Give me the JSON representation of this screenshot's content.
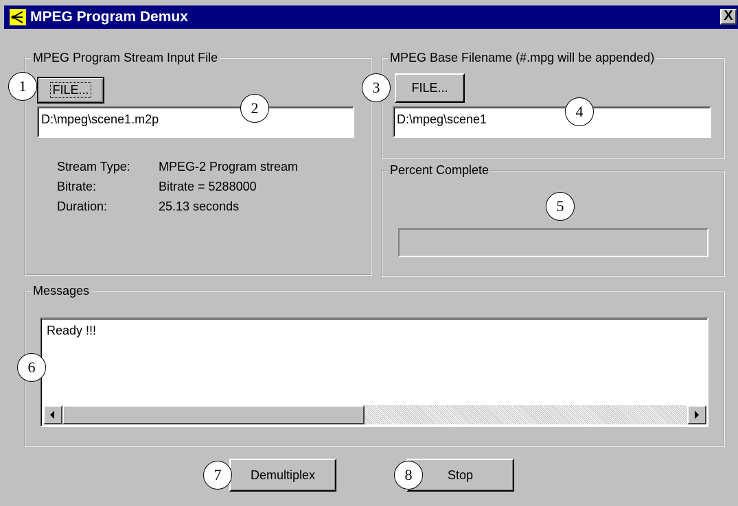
{
  "window": {
    "title": "MPEG Program Demux",
    "close_glyph": "X",
    "icon": "demux-app-icon"
  },
  "input_group": {
    "label": "MPEG Program Stream Input File",
    "file_button": "FILE...",
    "path_value": "D:\\mpeg\\scene1.m2p",
    "info": [
      {
        "label": "Stream Type:",
        "value": "MPEG-2 Program stream"
      },
      {
        "label": "Bitrate:",
        "value": "Bitrate = 5288000"
      },
      {
        "label": "Duration:",
        "value": "25.13 seconds"
      }
    ]
  },
  "output_group": {
    "label": "MPEG Base Filename (#.mpg will be appended)",
    "file_button": "FILE...",
    "path_value": "D:\\mpeg\\scene1"
  },
  "progress_group": {
    "label": "Percent Complete",
    "percent_complete": 0
  },
  "messages_group": {
    "label": "Messages",
    "text": "Ready !!!"
  },
  "actions": {
    "demultiplex_label": "Demultiplex",
    "stop_label": "Stop"
  },
  "callouts": [
    "1",
    "2",
    "3",
    "4",
    "5",
    "6",
    "7",
    "8"
  ]
}
